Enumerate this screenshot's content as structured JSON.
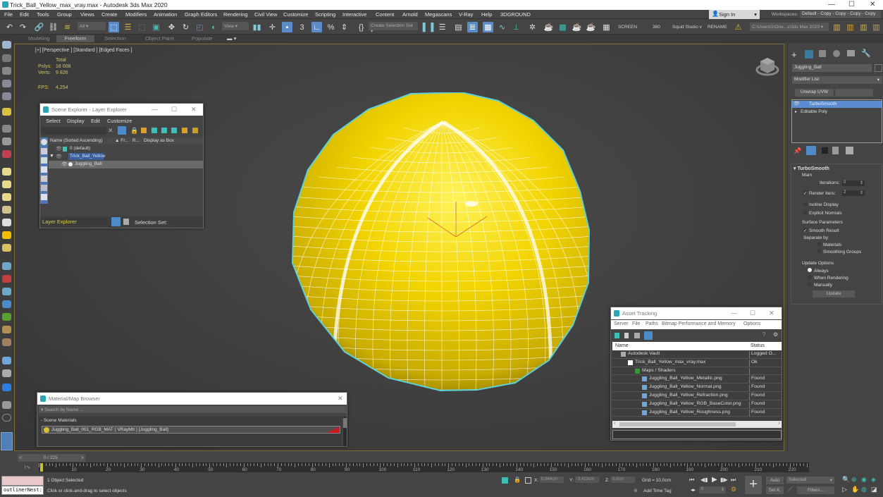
{
  "window": {
    "title": "Trick_Ball_Yellow_max_vray.max - Autodesk 3ds Max 2020",
    "controls": {
      "minimize": "—",
      "maximize": "☐",
      "close": "✕"
    }
  },
  "menubar": {
    "items": [
      "File",
      "Edit",
      "Tools",
      "Group",
      "Views",
      "Create",
      "Modifiers",
      "Animation",
      "Graph Editors",
      "Rendering",
      "Civil View",
      "Customize",
      "Scripting",
      "Interactive",
      "Content",
      "Arnold",
      "Megascans",
      "V-Ray",
      "Help",
      "3DGROUND"
    ],
    "sign_in": "Sign In",
    "workspaces_label": "Workspaces:",
    "workspace_value": "Default - Copy - Copy - Copy - Copy"
  },
  "toolbar": {
    "selection_filter": "All",
    "reference_coord": "View",
    "named_selection": "Create Selection Set",
    "screen_label": "SCREEN",
    "deg_label": "360",
    "squid_label": "Squid Studio v",
    "rename_label": "RENAME",
    "project_path": "C:\\Users\\1\\One...s\\3ds Max 2020"
  },
  "ribbon": {
    "tabs": [
      "Modeling",
      "Freeform",
      "Selection",
      "Object Paint",
      "Populate"
    ],
    "active": "Freeform"
  },
  "viewport": {
    "label": "[+] [Perspective ] [Standard ] [Edged Faces ]",
    "stats": {
      "total_label": "Total",
      "polys_label": "Polys:",
      "polys_value": "16 008",
      "verts_label": "Verts:",
      "verts_value": "9 826",
      "fps_label": "FPS:",
      "fps_value": "4,254"
    },
    "object_color": "#f2d400",
    "selection_color": "#5fd0d6"
  },
  "scene_explorer": {
    "title": "Scene Explorer - Layer Explorer",
    "menu": [
      "Select",
      "Display",
      "Edit",
      "Customize"
    ],
    "columns": [
      "Name (Sorted Ascending)",
      "▲ Fr...",
      "R...",
      "Display as Box"
    ],
    "rows": [
      {
        "name": "0 (default)",
        "level": 0
      },
      {
        "name": "Trick_Ball_Yellow",
        "level": 1,
        "selected": true
      },
      {
        "name": "Juggling_Ball",
        "level": 2,
        "highlighted": true
      }
    ],
    "footer_dropdown": "Layer Explorer",
    "selection_set_label": "Selection Set:"
  },
  "command_panel": {
    "object_name": "Juggling_Ball",
    "modifier_list": "Modifier List",
    "unwrap_button": "Unwrap UVW",
    "stack": [
      "TurboSmooth",
      "Editable Poly"
    ],
    "rollout_title": "TurboSmooth",
    "main_label": "Main",
    "iterations_label": "Iterations:",
    "iterations_value": "0",
    "render_iters_label": "Render Iters:",
    "render_iters_value": "2",
    "isoline_label": "Isoline Display",
    "explicit_normals_label": "Explicit Normals",
    "surface_params_label": "Surface Parameters",
    "smooth_result_label": "Smooth Result",
    "separate_by_label": "Separate by:",
    "materials_label": "Materials",
    "smoothing_groups_label": "Smoothing Groups",
    "update_options_label": "Update Options",
    "always_label": "Always",
    "when_rendering_label": "When Rendering",
    "manually_label": "Manually",
    "update_button": "Update"
  },
  "asset_tracking": {
    "title": "Asset Tracking",
    "menu": [
      "Server",
      "File",
      "Paths",
      "Bitmap Performance and Memory",
      "Options"
    ],
    "columns": [
      "Name",
      "Status"
    ],
    "rows": [
      {
        "name": "Autodesk Vault",
        "status": "Logged O...",
        "level": 0
      },
      {
        "name": "Trick_Ball_Yellow_max_vray.max",
        "status": "Ok",
        "level": 1
      },
      {
        "name": "Maps / Shaders",
        "status": "",
        "level": 2
      },
      {
        "name": "Juggling_Ball_Yellow_Metallic.png",
        "status": "Found",
        "level": 3
      },
      {
        "name": "Juggling_Ball_Yellow_Normal.png",
        "status": "Found",
        "level": 3
      },
      {
        "name": "Juggling_Ball_Yellow_Refraction.png",
        "status": "Found",
        "level": 3
      },
      {
        "name": "Juggling_Ball_Yellow_RGB_BaseColor.png",
        "status": "Found",
        "level": 3
      },
      {
        "name": "Juggling_Ball_Yellow_Roughness.png",
        "status": "Found",
        "level": 3
      }
    ]
  },
  "material_browser": {
    "title": "Material/Map Browser",
    "search_placeholder": "Search by Name ...",
    "section": "- Scene Materials",
    "item": "Juggling_Ball_001_RGB_MAT  ( VRayMtl ) [Juggling_Ball]"
  },
  "timeline": {
    "frame_display": "0 / 225",
    "ticks": [
      "10",
      "20",
      "30",
      "40",
      "50",
      "60",
      "70",
      "80",
      "90",
      "100",
      "110",
      "120",
      "130",
      "140",
      "150",
      "160",
      "170",
      "180",
      "190",
      "200",
      "210",
      "220"
    ],
    "current_frame": 0,
    "total_frames": 225
  },
  "status": {
    "maxscript_listener": "outlinerNest:",
    "selection": "1 Object Selected",
    "prompt": "Click or click-and-drag to select objects",
    "x_label": "X:",
    "x_value": "8,044cm",
    "y_label": "Y:",
    "y_value": "-3,413cm",
    "z_label": "Z:",
    "z_value": "0,0cm",
    "grid": "Grid = 10,0cm",
    "add_time_tag": "Add Time Tag",
    "frame_value": "0",
    "auto_key": "Auto",
    "set_key": "Set K.",
    "key_filter_select": "Selected",
    "filters": "Filters..."
  }
}
